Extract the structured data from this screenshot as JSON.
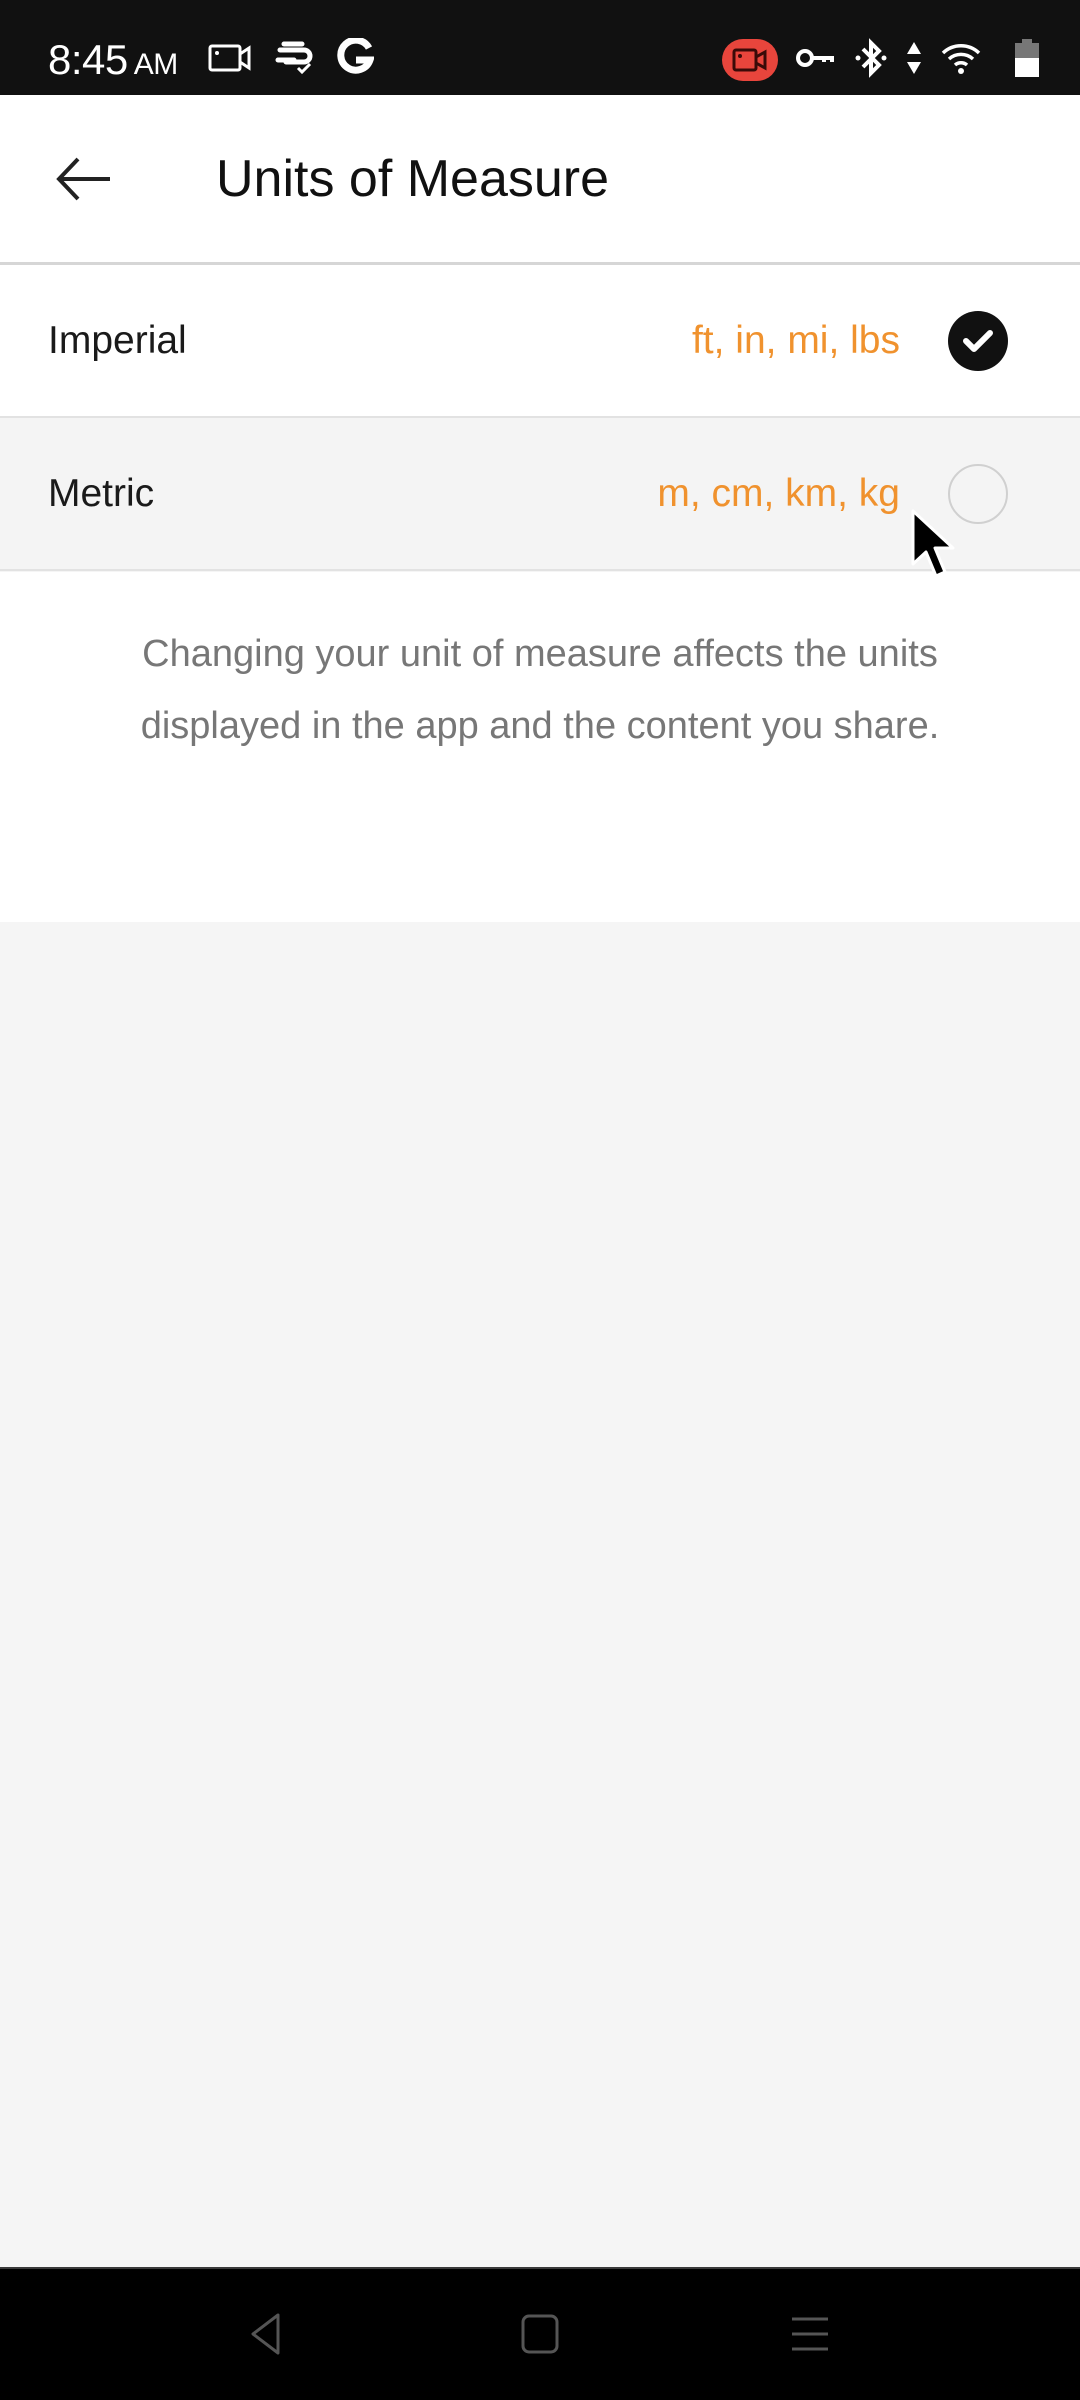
{
  "status_bar": {
    "time": "8:45",
    "ampm": "AM",
    "left_icons": [
      "screen-record-icon",
      "sync-check-icon",
      "google-icon"
    ],
    "right_icons": [
      "recording-active-icon",
      "vpn-key-icon",
      "bluetooth-icon",
      "data-transfer-icon",
      "wifi-icon",
      "battery-icon"
    ],
    "recording_color": "#e8453c"
  },
  "header": {
    "back_icon": "arrow-left-icon",
    "title": "Units of Measure"
  },
  "units": [
    {
      "label": "Imperial",
      "abbreviations": "ft, in, mi, lbs",
      "selected": true
    },
    {
      "label": "Metric",
      "abbreviations": "m, cm, km, kg",
      "selected": false
    }
  ],
  "description": "Changing your unit of measure affects the units displayed in the app and the content you share.",
  "colors": {
    "accent": "#f0922e",
    "selected_check": "#111111",
    "description_text": "#777777"
  },
  "nav_bar": {
    "buttons": [
      "back-triangle-icon",
      "home-square-icon",
      "menu-lines-icon"
    ]
  }
}
